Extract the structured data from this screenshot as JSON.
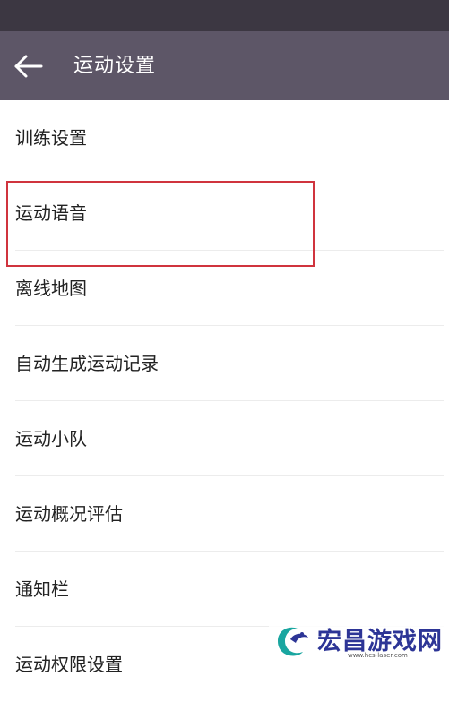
{
  "header": {
    "title": "运动设置",
    "back_icon": "arrow-left-icon"
  },
  "colors": {
    "status_bar": "#3c3742",
    "app_bar": "#5d5667",
    "highlight": "#d0343e"
  },
  "settings": {
    "items": [
      {
        "label": "训练设置"
      },
      {
        "label": "运动语音"
      },
      {
        "label": "离线地图"
      },
      {
        "label": "自动生成运动记录"
      },
      {
        "label": "运动小队"
      },
      {
        "label": "运动概况评估"
      },
      {
        "label": "通知栏"
      },
      {
        "label": "运动权限设置"
      }
    ]
  },
  "watermark": {
    "text": "宏昌游戏网",
    "url": "www.hcs-laser.com"
  }
}
